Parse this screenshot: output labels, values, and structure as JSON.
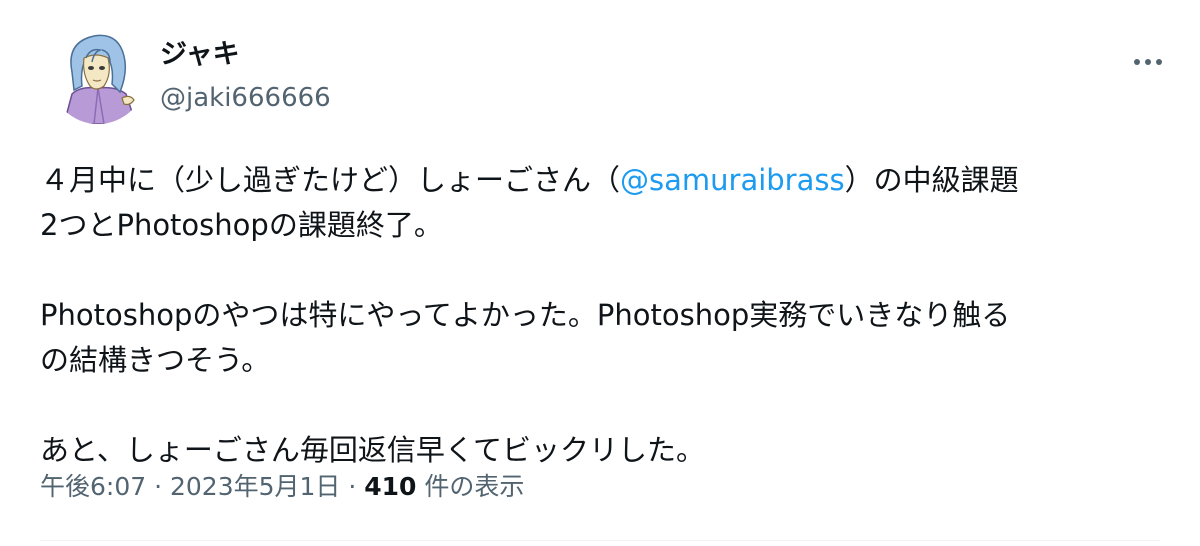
{
  "author": {
    "display_name": "ジャキ",
    "handle": "@jaki666666"
  },
  "more_icon": "more-horizontal-icon",
  "tweet": {
    "line1_before": "４月中に（少し過ぎたけど）しょーごさん（",
    "mention": "@samuraibrass",
    "line1_after": "）の中級課題",
    "line2": "2つとPhotoshopの課題終了。",
    "line3": "Photoshopのやつは特にやってよかった。Photoshop実務でいきなり触る",
    "line4": "の結構きつそう。",
    "line5": "あと、しょーごさん毎回返信早くてビックリした。"
  },
  "meta": {
    "time": "午後6:07",
    "separator1": " · ",
    "date": "2023年5月1日",
    "separator2": " · ",
    "views_count": "410",
    "views_label": " 件の表示"
  },
  "colors": {
    "text_primary": "#0f1419",
    "text_secondary": "#536471",
    "link": "#1d9bf0"
  }
}
